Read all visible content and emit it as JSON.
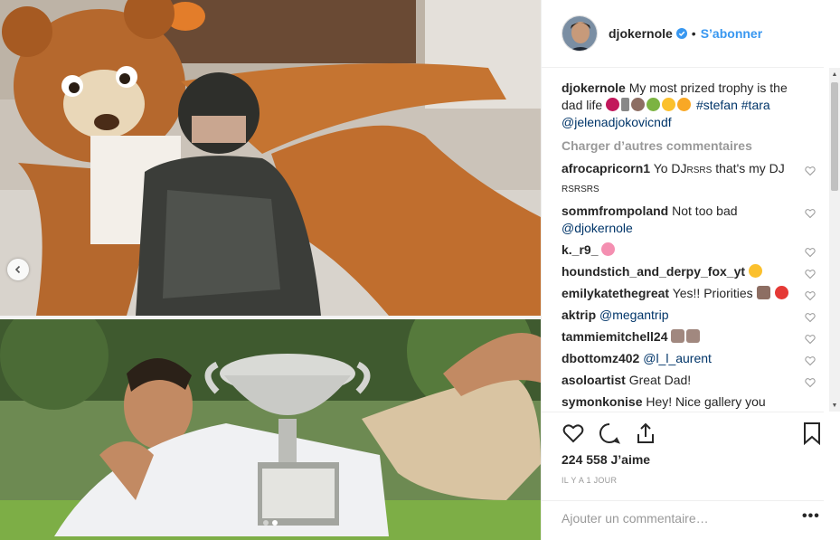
{
  "post": {
    "username": "djokernole",
    "follow_label": "S’abonner",
    "separator": "•",
    "caption_text": "My most prized trophy is the dad life",
    "caption_tags": [
      "#stefan",
      "#tara"
    ],
    "caption_mention": "@jelenadjokovicndf",
    "load_more": "Charger d’autres commentaires"
  },
  "comments": [
    {
      "user": "afrocapricorn1",
      "text": "Yo DJ",
      "text2": "RSRS",
      "text3": "that's my DJ",
      "text4": "RSRSRS"
    },
    {
      "user": "sommfrompoland",
      "text": "Not too bad",
      "mention": "@djokernole"
    },
    {
      "user": "k._r9_",
      "text": ""
    },
    {
      "user": "houndstich_and_derpy_fox_yt",
      "text": ""
    },
    {
      "user": "emilykatethegreat",
      "text": "Yes!! Priorities"
    },
    {
      "user": "aktrip",
      "mention": "@megantrip"
    },
    {
      "user": "tammiemitchell24",
      "text": ""
    },
    {
      "user": "dbottomz402",
      "mention": "@l_l_aurent"
    },
    {
      "user": "asoloartist",
      "text": "Great Dad!"
    },
    {
      "user": "symonkonise",
      "text": "Hey! Nice gallery you"
    }
  ],
  "engagement": {
    "likes": "224 558 J’aime",
    "time": "IL Y A 1 JOUR",
    "add_comment_placeholder": "Ajouter un commentaire…",
    "more": "•••"
  },
  "icons": {
    "verified": "verified-badge-icon",
    "heart": "heart-icon",
    "comment": "comment-icon",
    "share": "share-icon",
    "save": "bookmark-icon",
    "prev": "chevron-left-icon"
  },
  "colors": {
    "accent": "#3897f0",
    "tag": "#003569",
    "muted": "#999999",
    "border": "#efefef"
  },
  "carousel": {
    "current": 1,
    "count": 2
  }
}
